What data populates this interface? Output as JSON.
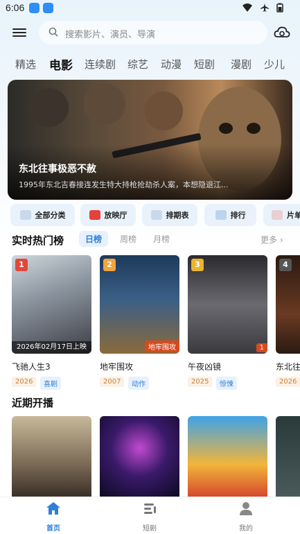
{
  "status": {
    "time": "6:06"
  },
  "search": {
    "placeholder": "搜索影片、演员、导演"
  },
  "categories": [
    "精选",
    "电影",
    "连续剧",
    "综艺",
    "动漫",
    "短剧",
    "漫剧",
    "少儿"
  ],
  "active_category": "电影",
  "banner": {
    "title": "东北往事极恶不赦",
    "desc": "1995年东北吉春接连发生特大持枪抢劫杀人案，本想隐退江..."
  },
  "quick": [
    "全部分类",
    "放映厅",
    "排期表",
    "排行",
    "片单"
  ],
  "hot": {
    "title": "实时热门榜",
    "tabs": [
      "日榜",
      "周榜",
      "月榜"
    ],
    "active_tab": "日榜",
    "more": "更多"
  },
  "movies": [
    {
      "rank": "1",
      "title": "飞驰人生3",
      "caption": "2026年02月17日上映",
      "year": "2026",
      "genre": "喜剧"
    },
    {
      "rank": "2",
      "title": "地牢围攻",
      "caption": "地牢围攻",
      "year": "2007",
      "genre": "动作"
    },
    {
      "rank": "3",
      "title": "午夜凶镜",
      "caption": "1",
      "year": "2025",
      "genre": "惊悚"
    },
    {
      "rank": "4",
      "title": "东北往",
      "caption": "",
      "year": "2026",
      "genre": ""
    }
  ],
  "upcoming": {
    "title": "近期开播"
  },
  "nav": [
    {
      "label": "首页",
      "active": true
    },
    {
      "label": "短剧",
      "active": false
    },
    {
      "label": "我的",
      "active": false
    }
  ],
  "colors": {
    "accent": "#2f7fd8",
    "rank1": "#e2473b",
    "rank2": "#f2a53a",
    "rank3": "#e8b52f",
    "rank4": "#555555"
  }
}
